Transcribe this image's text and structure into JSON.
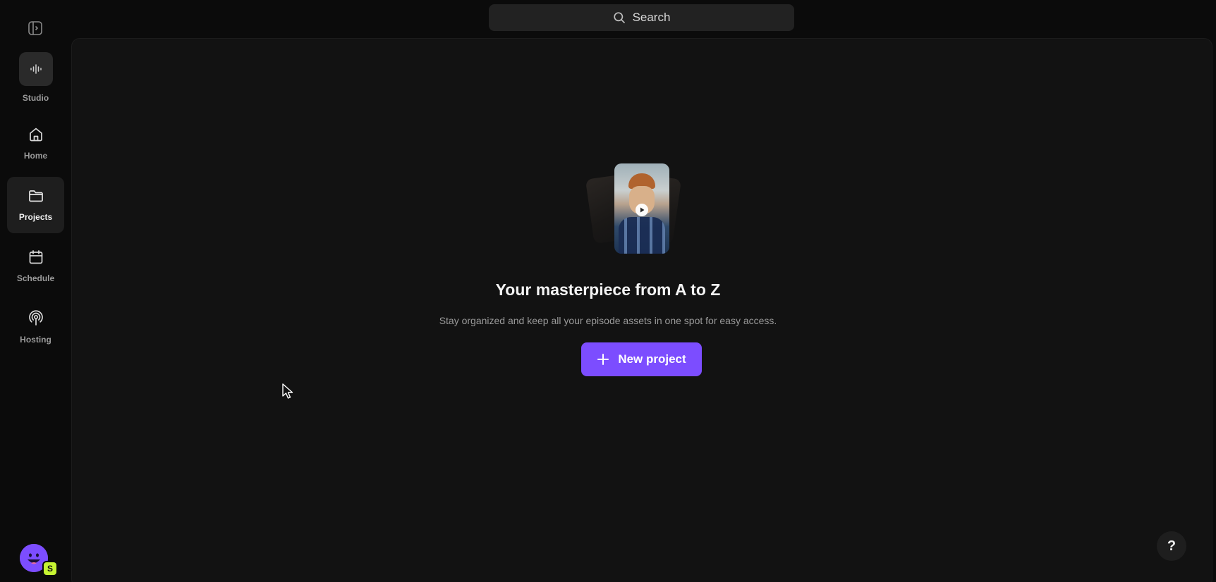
{
  "sidebar": {
    "toggle_icon": "sidebar-toggle-icon",
    "items": [
      {
        "label": "Studio",
        "icon": "waveform-icon",
        "active": false
      },
      {
        "label": "Home",
        "icon": "home-icon",
        "active": false
      },
      {
        "label": "Projects",
        "icon": "folder-icon",
        "active": true
      },
      {
        "label": "Schedule",
        "icon": "calendar-icon",
        "active": false
      },
      {
        "label": "Hosting",
        "icon": "podcast-icon",
        "active": false
      }
    ],
    "avatar": {
      "icon": "smiley-face-icon",
      "badge": "S"
    }
  },
  "search": {
    "label": "Search",
    "icon": "search-icon"
  },
  "empty_state": {
    "headline": "Your masterpiece from A to Z",
    "subtext": "Stay organized and keep all your episode assets in one spot for easy access.",
    "button_label": "New project",
    "button_icon": "plus-icon"
  },
  "help": {
    "label": "?"
  },
  "colors": {
    "accent": "#7c4dff",
    "badge": "#c6f432",
    "background": "#0b0b0b",
    "panel": "#121212"
  }
}
